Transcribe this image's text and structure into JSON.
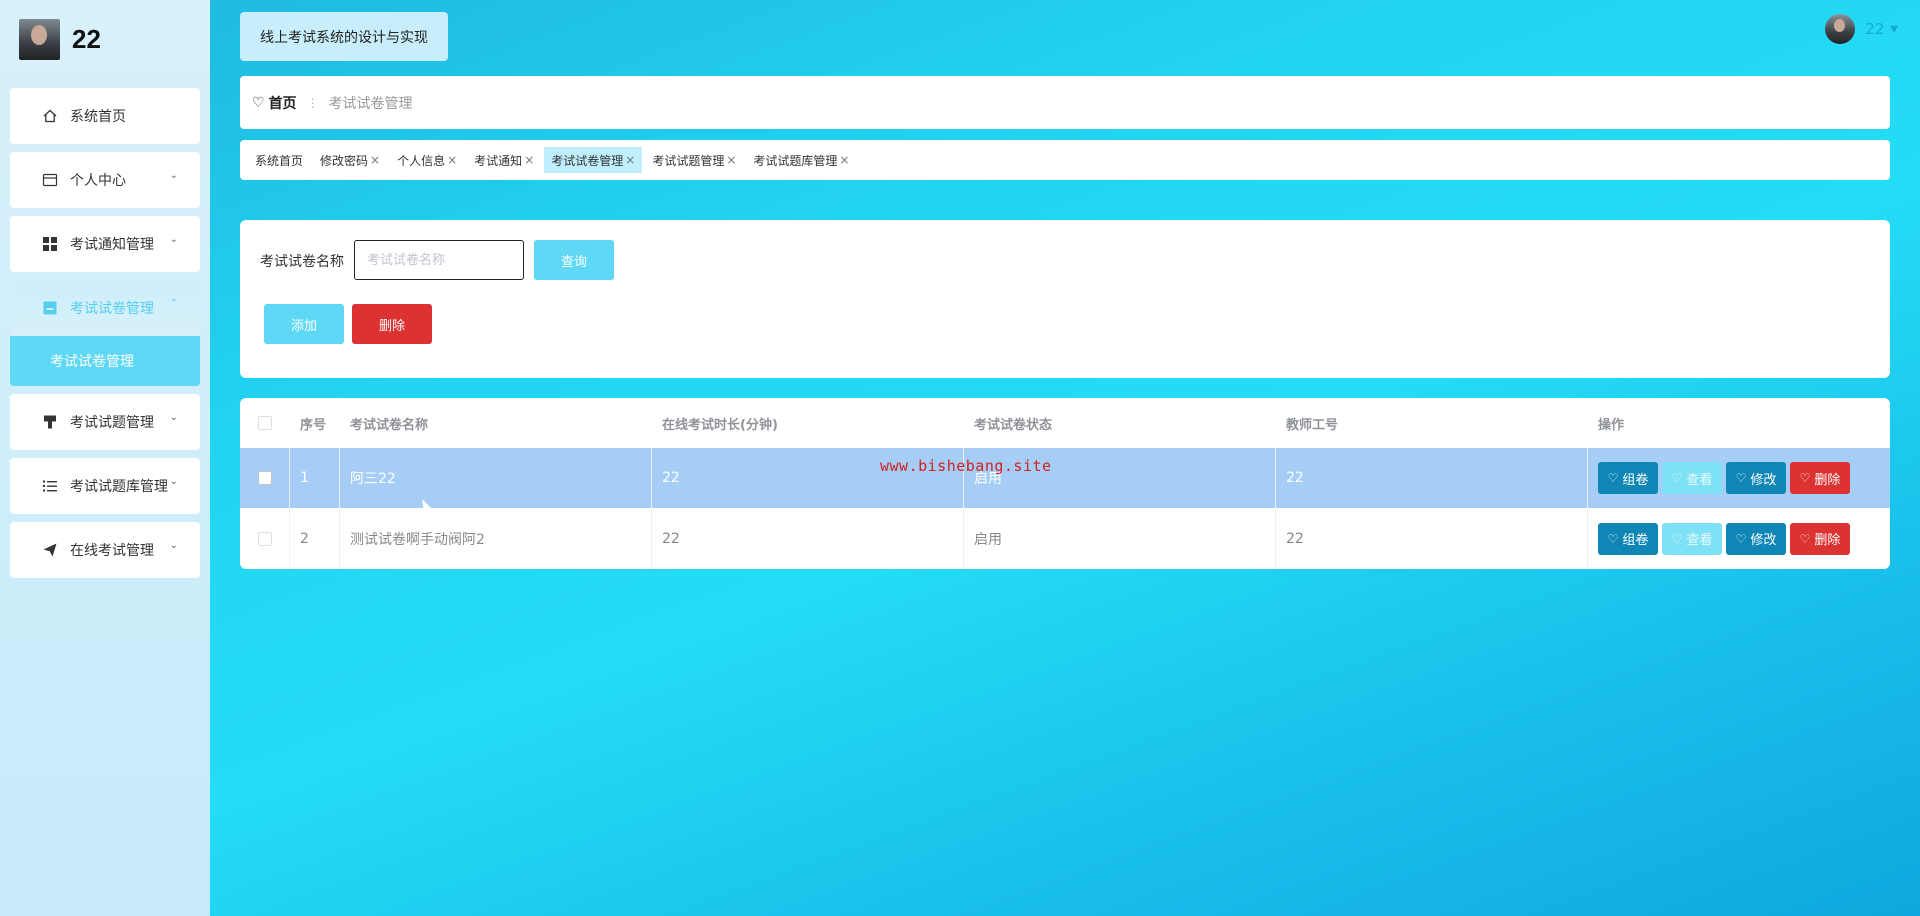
{
  "brand": {
    "name": "22"
  },
  "sidebar": {
    "items": [
      {
        "label": "系统首页",
        "icon": "home-icon",
        "has_chevron": false
      },
      {
        "label": "个人中心",
        "icon": "profile-icon",
        "has_chevron": true
      },
      {
        "label": "考试通知管理",
        "icon": "grid-icon",
        "has_chevron": true
      },
      {
        "label": "考试试卷管理",
        "icon": "document-icon",
        "has_chevron": true,
        "active": true
      },
      {
        "label": "考试试题管理",
        "icon": "brush-icon",
        "has_chevron": true
      },
      {
        "label": "考试试题库管理",
        "icon": "list-icon",
        "has_chevron": true
      },
      {
        "label": "在线考试管理",
        "icon": "paper-plane-icon",
        "has_chevron": true
      }
    ],
    "submenu": {
      "label": "考试试卷管理"
    }
  },
  "header": {
    "system_title": "线上考试系统的设计与实现",
    "user_name": "22"
  },
  "breadcrumb": {
    "home": "首页",
    "current": "考试试卷管理"
  },
  "tags": [
    {
      "label": "系统首页",
      "closable": false
    },
    {
      "label": "修改密码",
      "closable": true
    },
    {
      "label": "个人信息",
      "closable": true
    },
    {
      "label": "考试通知",
      "closable": true
    },
    {
      "label": "考试试卷管理",
      "closable": true,
      "active": true
    },
    {
      "label": "考试试题管理",
      "closable": true
    },
    {
      "label": "考试试题库管理",
      "closable": true
    }
  ],
  "search": {
    "label": "考试试卷名称",
    "placeholder": "考试试卷名称",
    "value": "",
    "query_button": "查询",
    "add_button": "添加",
    "delete_button": "删除"
  },
  "table": {
    "columns": [
      "序号",
      "考试试卷名称",
      "在线考试时长(分钟)",
      "考试试卷状态",
      "教师工号",
      "操作"
    ],
    "rows": [
      {
        "index": "1",
        "name": "阿三22",
        "duration": "22",
        "status": "启用",
        "teacher": "22",
        "selected": true
      },
      {
        "index": "2",
        "name": "测试试卷啊手动阀阿2",
        "duration": "22",
        "status": "启用",
        "teacher": "22",
        "selected": false
      }
    ],
    "actions": [
      "组卷",
      "查看",
      "修改",
      "删除"
    ]
  },
  "watermark": "www.bishebang.site",
  "colors": {
    "accent": "#5fd8f5",
    "primary_dark": "#0f86b5",
    "danger": "#dc3232",
    "selected_row": "#a6cdf6"
  }
}
